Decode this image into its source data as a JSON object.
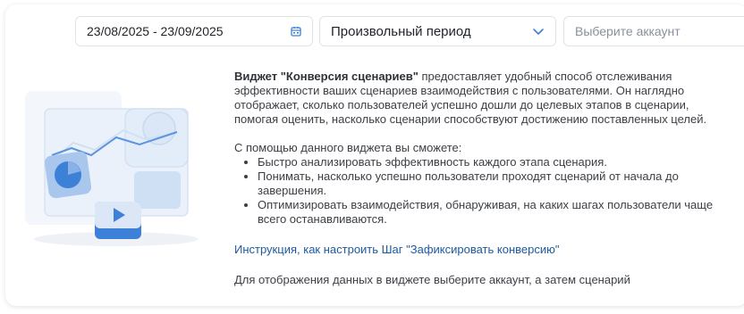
{
  "filters": {
    "date_range": "23/08/2025 - 23/09/2025",
    "period_select": "Произвольный период",
    "account_placeholder": "Выберите аккаунт"
  },
  "icons": {
    "calendar": "calendar-icon",
    "dropdown": "chevron-down-icon",
    "illustration": "analytics-illustration"
  },
  "widget": {
    "intro_bold": "Виджет \"Конверсия сценариев\"",
    "intro_rest": " предоставляет удобный способ отслеживания эффективности ваших сценариев взаимодействия с пользователями. Он наглядно отображает, сколько пользователей успешно дошли до целевых этапов в сценарии, помогая оценить, насколько сценарии способствуют достижению поставленных целей.",
    "capabilities_heading": "С помощью данного виджета вы сможете:",
    "capabilities": [
      "Быстро анализировать эффективность каждого этапа сценария.",
      "Понимать, насколько успешно пользователи проходят сценарий от начала до завершения.",
      "Оптимизировать взаимодействия, обнаруживая, на каких шагах пользователи чаще всего останавливаются."
    ],
    "instruction_link": "Инструкция, как настроить Шаг \"Зафиксировать конверсию\"",
    "hint": "Для отображения данных в виджете выберите аккаунт, а затем сценарий"
  },
  "colors": {
    "accent": "#1c5a9e",
    "illustration_light": "#e6eef8",
    "illustration_mid": "#a9c6ec",
    "illustration_dark": "#3d80d8"
  }
}
